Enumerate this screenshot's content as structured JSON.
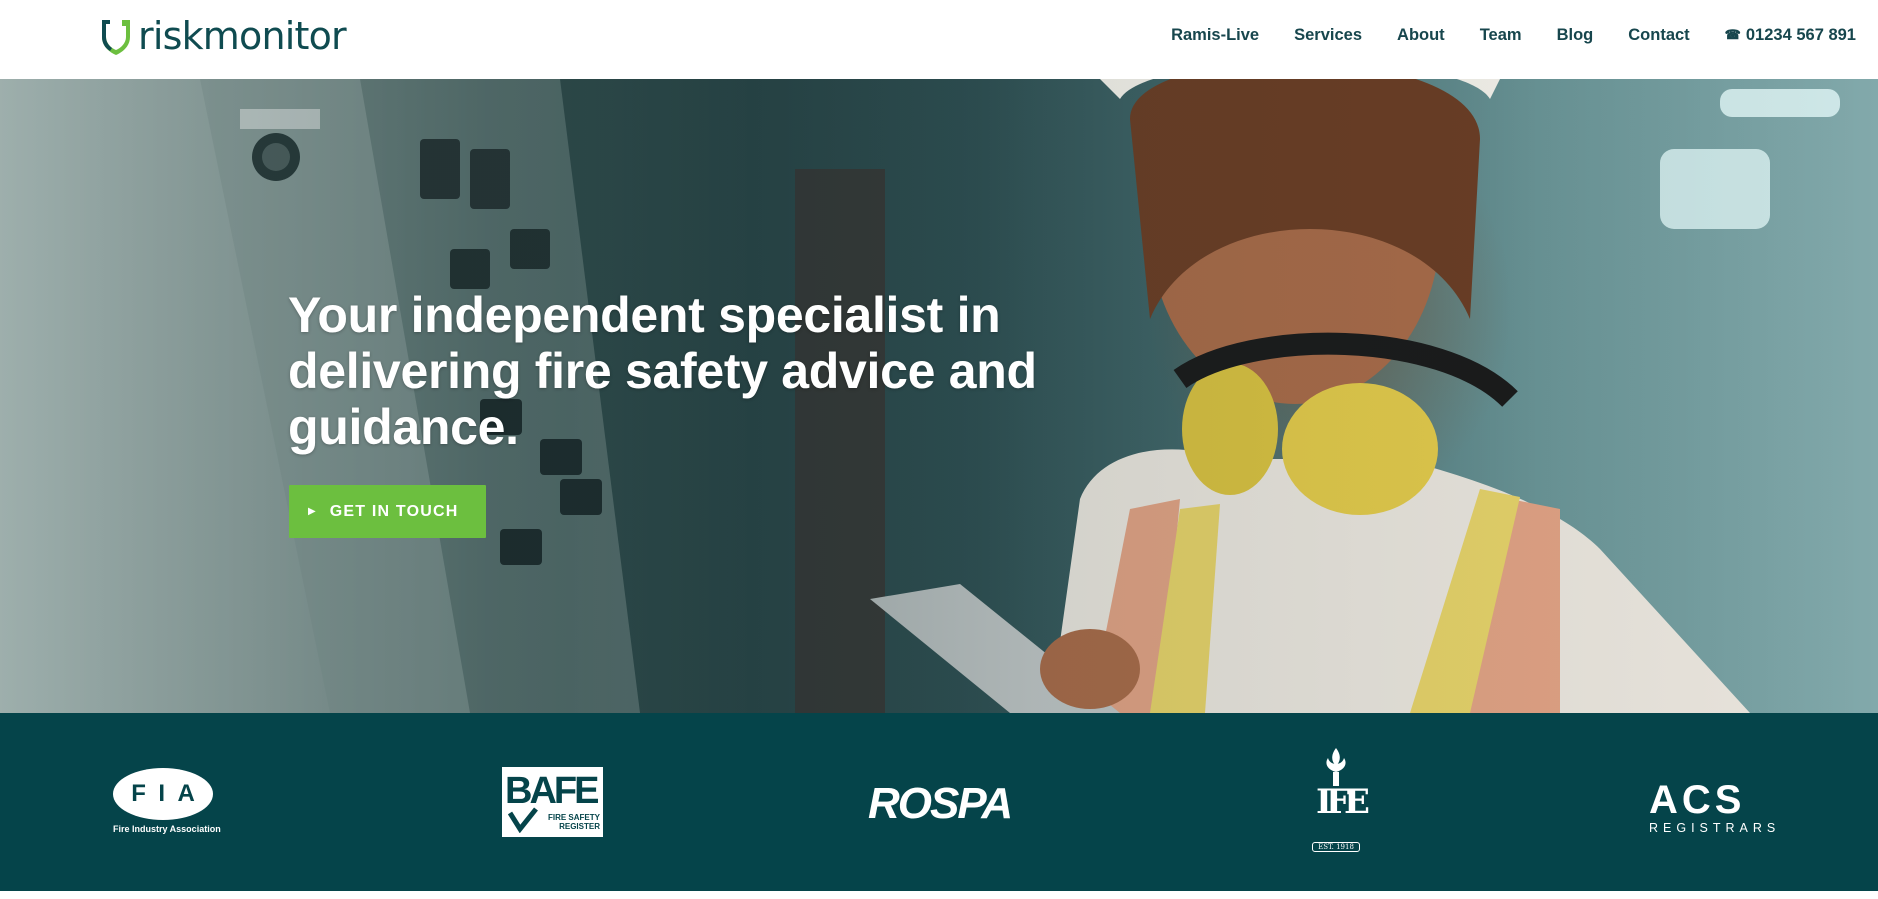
{
  "brand": {
    "name": "riskmonitor",
    "primary_color": "#0f4b50",
    "accent_color": "#6cbf3f",
    "dark_teal": "#05444a"
  },
  "nav": {
    "items": [
      {
        "label": "Ramis-Live"
      },
      {
        "label": "Services"
      },
      {
        "label": "About"
      },
      {
        "label": "Team"
      },
      {
        "label": "Blog"
      },
      {
        "label": "Contact"
      }
    ],
    "phone": {
      "icon": "phone-icon",
      "number": "01234 567 891"
    }
  },
  "hero": {
    "headline": "Your independent specialist in delivering fire safety advice and guidance.",
    "cta_label": "GET IN TOUCH",
    "cta_icon": "play-icon",
    "image": "worker-in-factory-photo"
  },
  "accreditations": {
    "fia": {
      "letters": [
        "F",
        "I",
        "A"
      ],
      "caption": "Fire Industry Association"
    },
    "bafe": {
      "word": "BAFE",
      "subtitle": "FIRE SAFETY REGISTER"
    },
    "rospa": {
      "word": "ROSPA"
    },
    "ife": {
      "monogram": "IFE",
      "est": "EST. 1918"
    },
    "acs": {
      "word": "ACS",
      "subtitle": "REGISTRARS"
    }
  }
}
